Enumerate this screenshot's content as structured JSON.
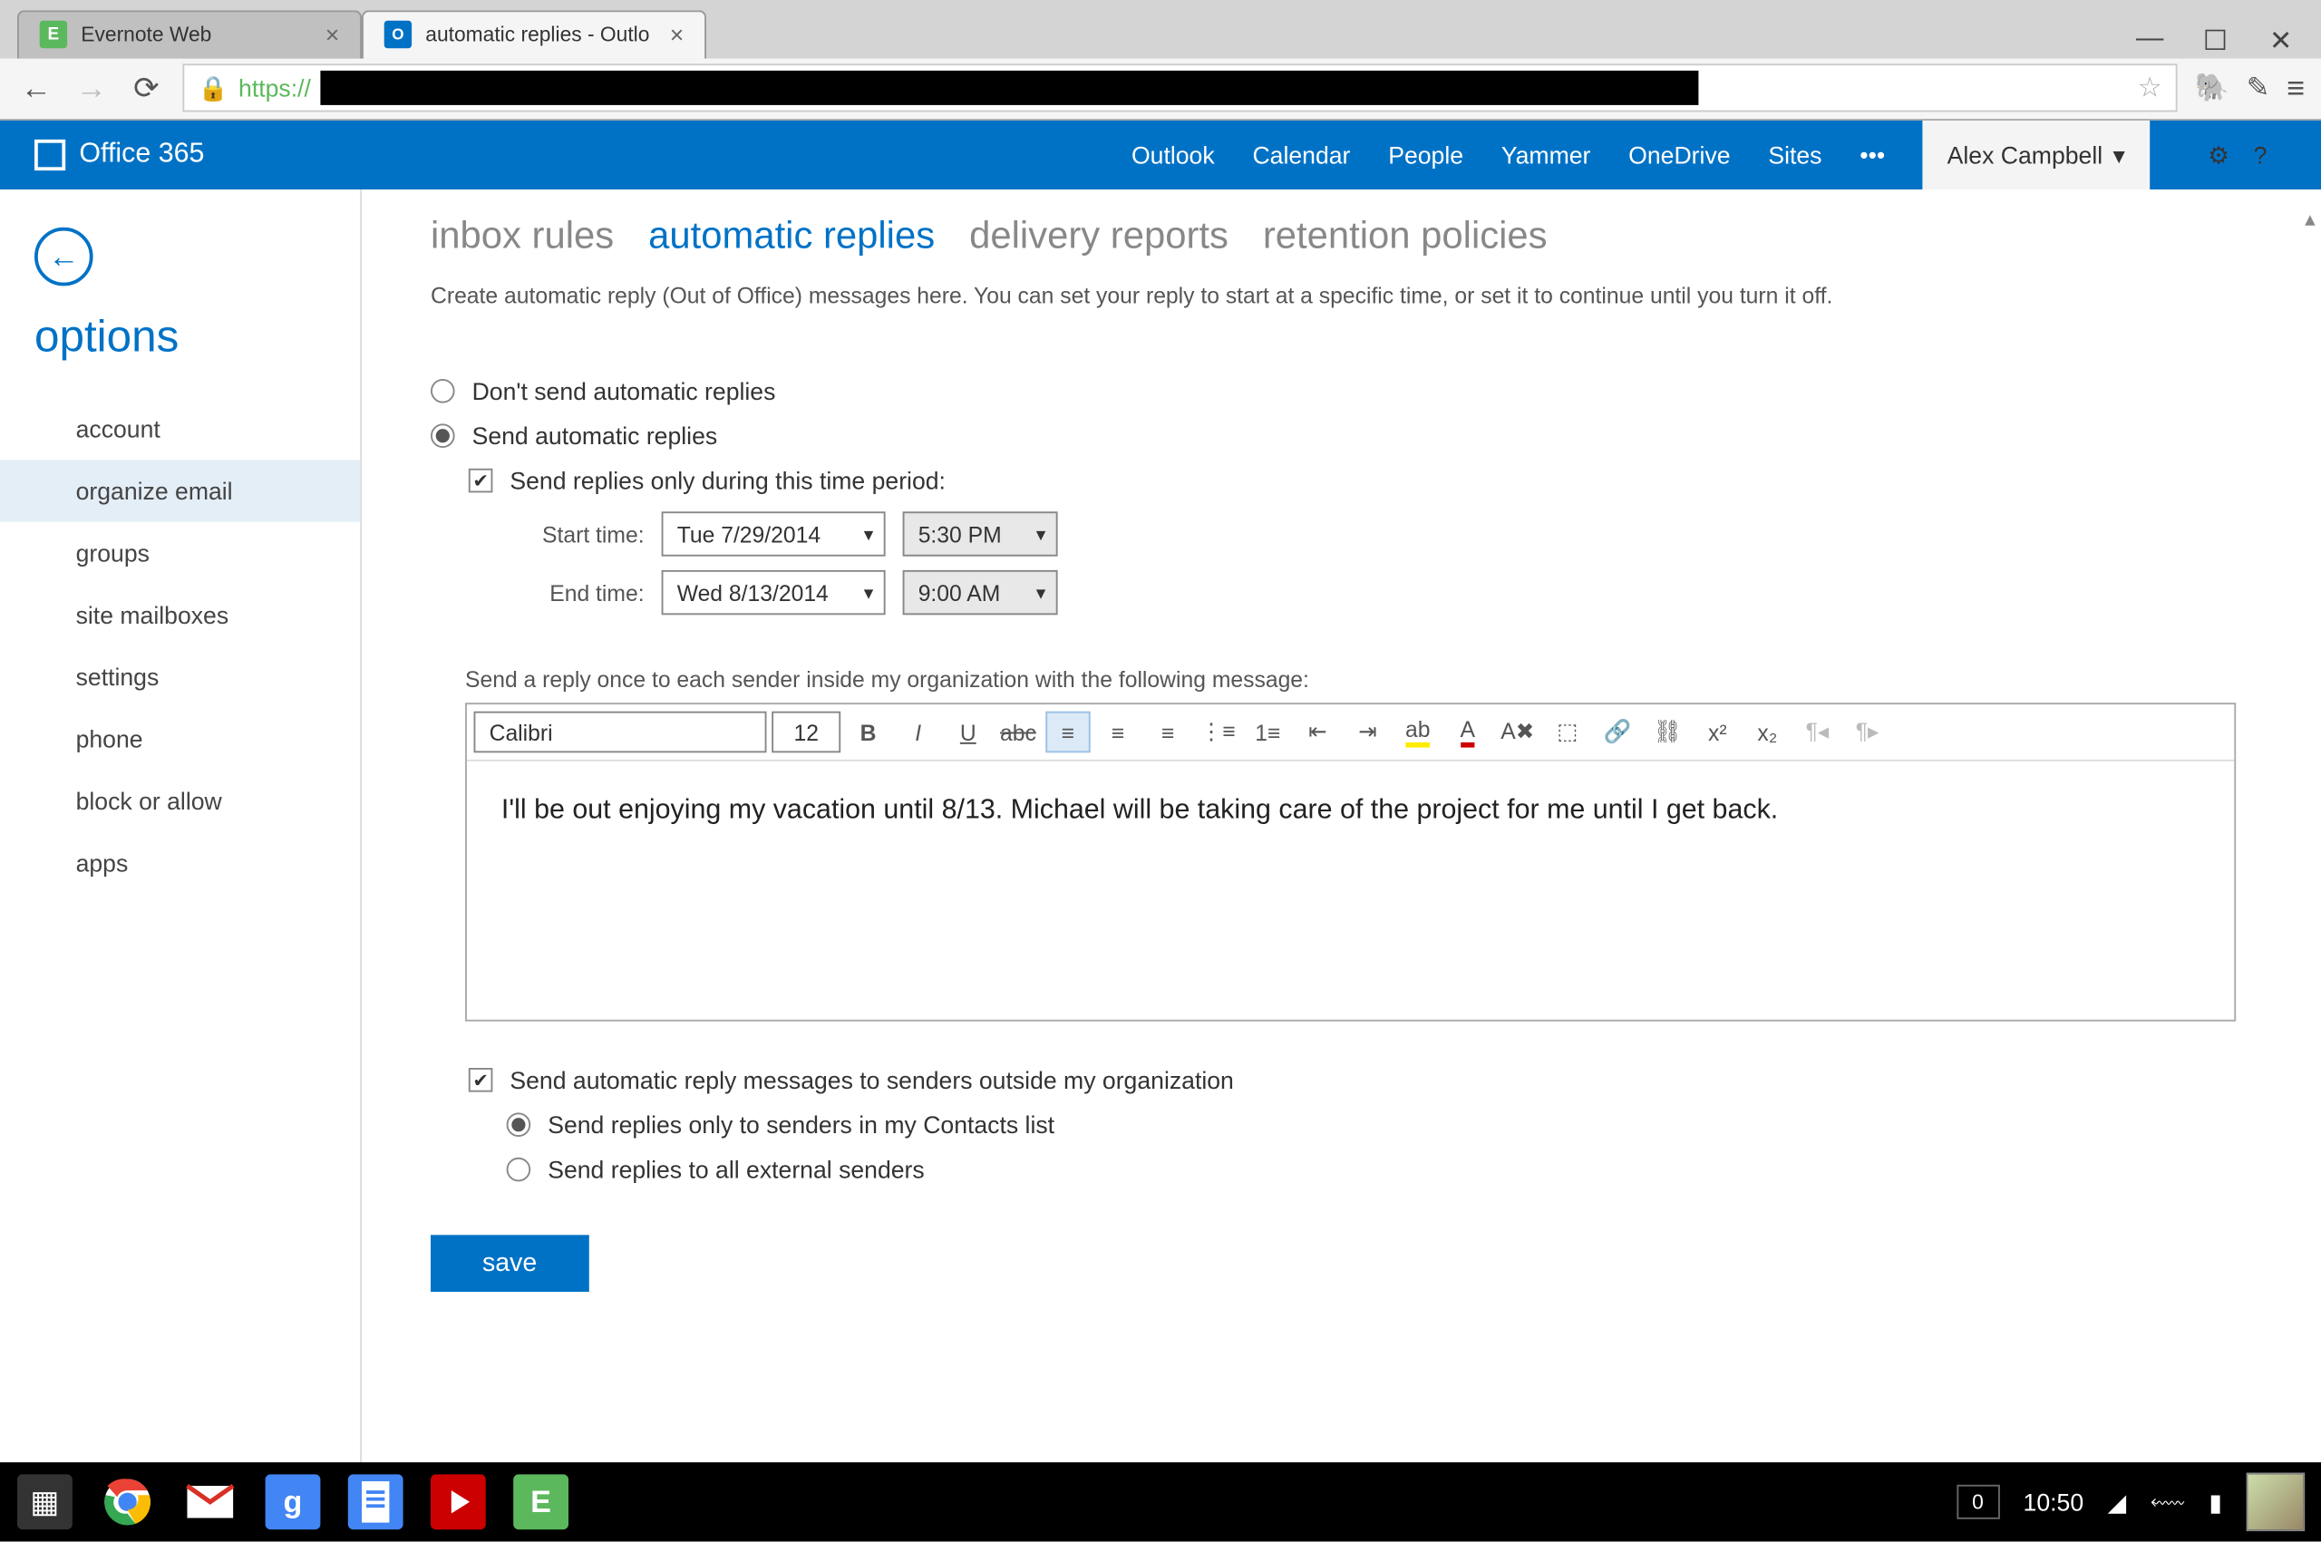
{
  "browser": {
    "tabs": [
      {
        "title": "Evernote Web",
        "active": false,
        "favicon": "evernote"
      },
      {
        "title": "automatic replies - Outlo",
        "active": true,
        "favicon": "outlook"
      }
    ],
    "url_prefix": "https://"
  },
  "o365": {
    "brand": "Office 365",
    "links": [
      "Outlook",
      "Calendar",
      "People",
      "Yammer",
      "OneDrive",
      "Sites"
    ],
    "more": "•••",
    "user": "Alex Campbell"
  },
  "sidebar": {
    "title": "options",
    "items": [
      "account",
      "organize email",
      "groups",
      "site mailboxes",
      "settings",
      "phone",
      "block or allow",
      "apps"
    ],
    "selected": "organize email"
  },
  "main": {
    "tabs": [
      "inbox rules",
      "automatic replies",
      "delivery reports",
      "retention policies"
    ],
    "selected_tab": "automatic replies",
    "description": "Create automatic reply (Out of Office) messages here. You can set your reply to start at a specific time, or set it to continue until you turn it off.",
    "radio_dont_send": "Don't send automatic replies",
    "radio_send": "Send automatic replies",
    "check_time_period": "Send replies only during this time period:",
    "start_label": "Start time:",
    "start_date": "Tue 7/29/2014",
    "start_time": "5:30 PM",
    "end_label": "End time:",
    "end_date": "Wed 8/13/2014",
    "end_time": "9:00 AM",
    "org_message_label": "Send a reply once to each sender inside my organization with the following message:",
    "editor": {
      "font": "Calibri",
      "size": "12",
      "body": "I'll be out enjoying my vacation until 8/13. Michael will be taking care of the project for me until I get back."
    },
    "check_external": "Send automatic reply messages to senders outside my organization",
    "radio_contacts": "Send replies only to senders in my Contacts list",
    "radio_all_external": "Send replies to all external senders",
    "save": "save"
  },
  "taskbar": {
    "count": "0",
    "time": "10:50"
  }
}
